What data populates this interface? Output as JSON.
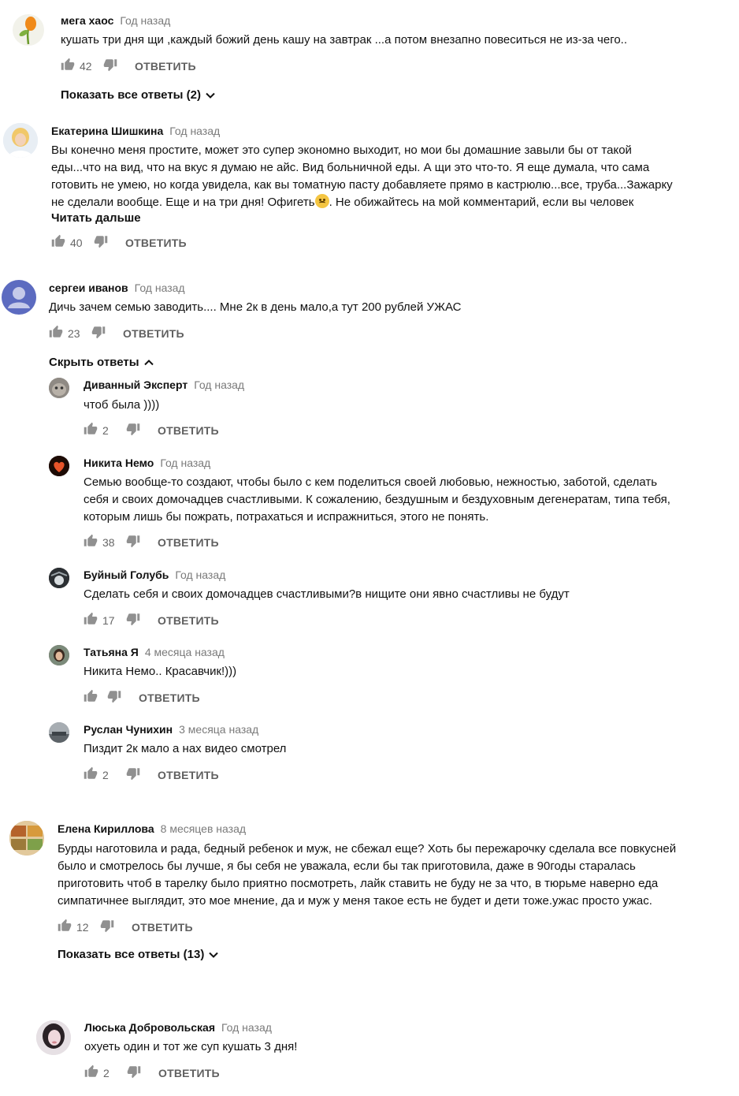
{
  "comments": [
    {
      "author": "мега хаос",
      "time": "Год назад",
      "lines": [
        "кушать три дня щи ,каждый божий день кашу на завтрак ...а потом внезапно  повеситься не из-за чего.."
      ],
      "likes": "42",
      "reply": "ОТВЕТИТЬ",
      "replies_toggle": "Показать все ответы (2)"
    },
    {
      "author": "Екатерина Шишкина",
      "time": "Год назад",
      "lines": [
        "Вы конечно меня простите, может это супер экономно выходит, но мои бы домашние завыли бы от такой",
        "еды...что на вид, что на вкус я думаю не айс. Вид больничной еды. А щи это что-то. Я еще думала, что сама",
        "готовить не умею, но когда увидела, как вы томатную пасту добавляете прямо в кастрюлю...все, труба...Зажарку",
        "не сделали вообще. Еще и на три дня! Офигеть",
        ". Не обижайтесь на мой комментарий, если вы человек"
      ],
      "read_more": "Читать дальше",
      "likes": "40",
      "reply": "ОТВЕТИТЬ"
    },
    {
      "author": "сергеи иванов",
      "time": "Год назад",
      "lines": [
        "Дичь зачем семью заводить.... Мне 2к в день мало,а тут 200 рублей УЖАС"
      ],
      "likes": "23",
      "reply": "ОТВЕТИТЬ",
      "replies_toggle": "Скрыть ответы",
      "replies": [
        {
          "author": "Диванный Эксперт",
          "time": "Год назад",
          "lines": [
            "чтоб была ))))"
          ],
          "likes": "2",
          "reply": "ОТВЕТИТЬ"
        },
        {
          "author": "Никита Немо",
          "time": "Год назад",
          "lines": [
            "Семью вообще-то создают, чтобы было с кем поделиться своей любовью, нежностью, заботой, сделать",
            "себя и своих домочадцев счастливыми. К сожалению, бездушным и бездуховным дегенератам, типа тебя,",
            "которым лишь бы пожрать, потрахаться и испражниться, этого не понять."
          ],
          "likes": "38",
          "reply": "ОТВЕТИТЬ"
        },
        {
          "author": "Буйный Голубь",
          "time": "Год назад",
          "lines": [
            "Сделать себя и своих домочадцев счастливыми?в нищите они явно счастливы не будут"
          ],
          "likes": "17",
          "reply": "ОТВЕТИТЬ"
        },
        {
          "author": "Татьяна Я",
          "time": "4 месяца назад",
          "lines": [
            "Никита Немо.. Красавчик!)))"
          ],
          "likes": "",
          "reply": "ОТВЕТИТЬ"
        },
        {
          "author": "Руслан Чунихин",
          "time": "3 месяца назад",
          "lines": [
            "Пиздит 2к мало а нах видео смотрел"
          ],
          "likes": "2",
          "reply": "ОТВЕТИТЬ"
        }
      ]
    },
    {
      "author": "Елена Кириллова",
      "time": "8 месяцев назад",
      "lines": [
        "Бурды наготовила и рада, бедный ребенок и муж, не сбежал еще? Хоть бы пережарочку сделала все повкусней",
        "было и смотрелось бы лучше, я бы себя не уважала, если бы так приготовила, даже в 90годы старалась",
        "приготовить чтоб в тарелку было приятно посмотреть, лайк ставить не буду не за что, в тюрьме наверно еда",
        "симпатичнее выглядит, это мое мнение, да и муж у меня такое есть не будет и дети тоже.ужас просто ужас."
      ],
      "likes": "12",
      "reply": "ОТВЕТИТЬ",
      "replies_toggle": "Показать все ответы (13)"
    },
    {
      "author": "Люська Добровольская",
      "time": "Год назад",
      "lines": [
        "охуеть один и тот же суп кушать 3 дня!"
      ],
      "likes": "2",
      "reply": "ОТВЕТИТЬ"
    }
  ],
  "colors": {
    "text": "#111111",
    "meta": "#7a7a7a",
    "icon": "#909090",
    "reply": "#606060"
  }
}
